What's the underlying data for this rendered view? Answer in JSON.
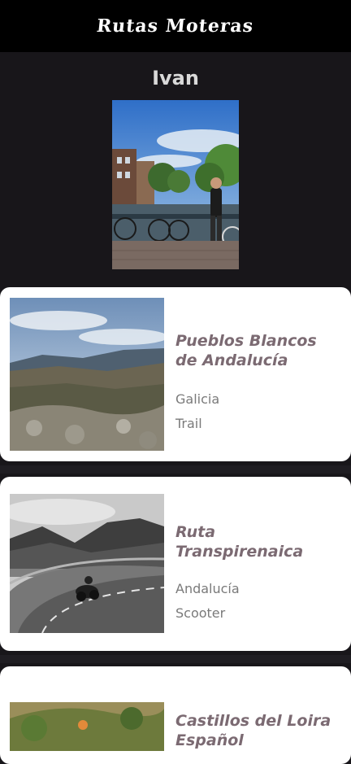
{
  "app": {
    "title": "Rutas Moteras"
  },
  "profile": {
    "name": "Ivan"
  },
  "routes": [
    {
      "name": "Pueblos Blancos de Andalucía",
      "region": "Galicia",
      "vehicle": "Trail"
    },
    {
      "name": "Ruta Transpirenaica",
      "region": "Andalucía",
      "vehicle": "Scooter"
    },
    {
      "name": "Castillos del Loira Español",
      "region": "",
      "vehicle": ""
    }
  ],
  "colors": {
    "appbar": "#000000",
    "background": "#18161a",
    "card": "#ffffff",
    "route_title": "#7b6a72",
    "meta_text": "#7a7a7a"
  }
}
